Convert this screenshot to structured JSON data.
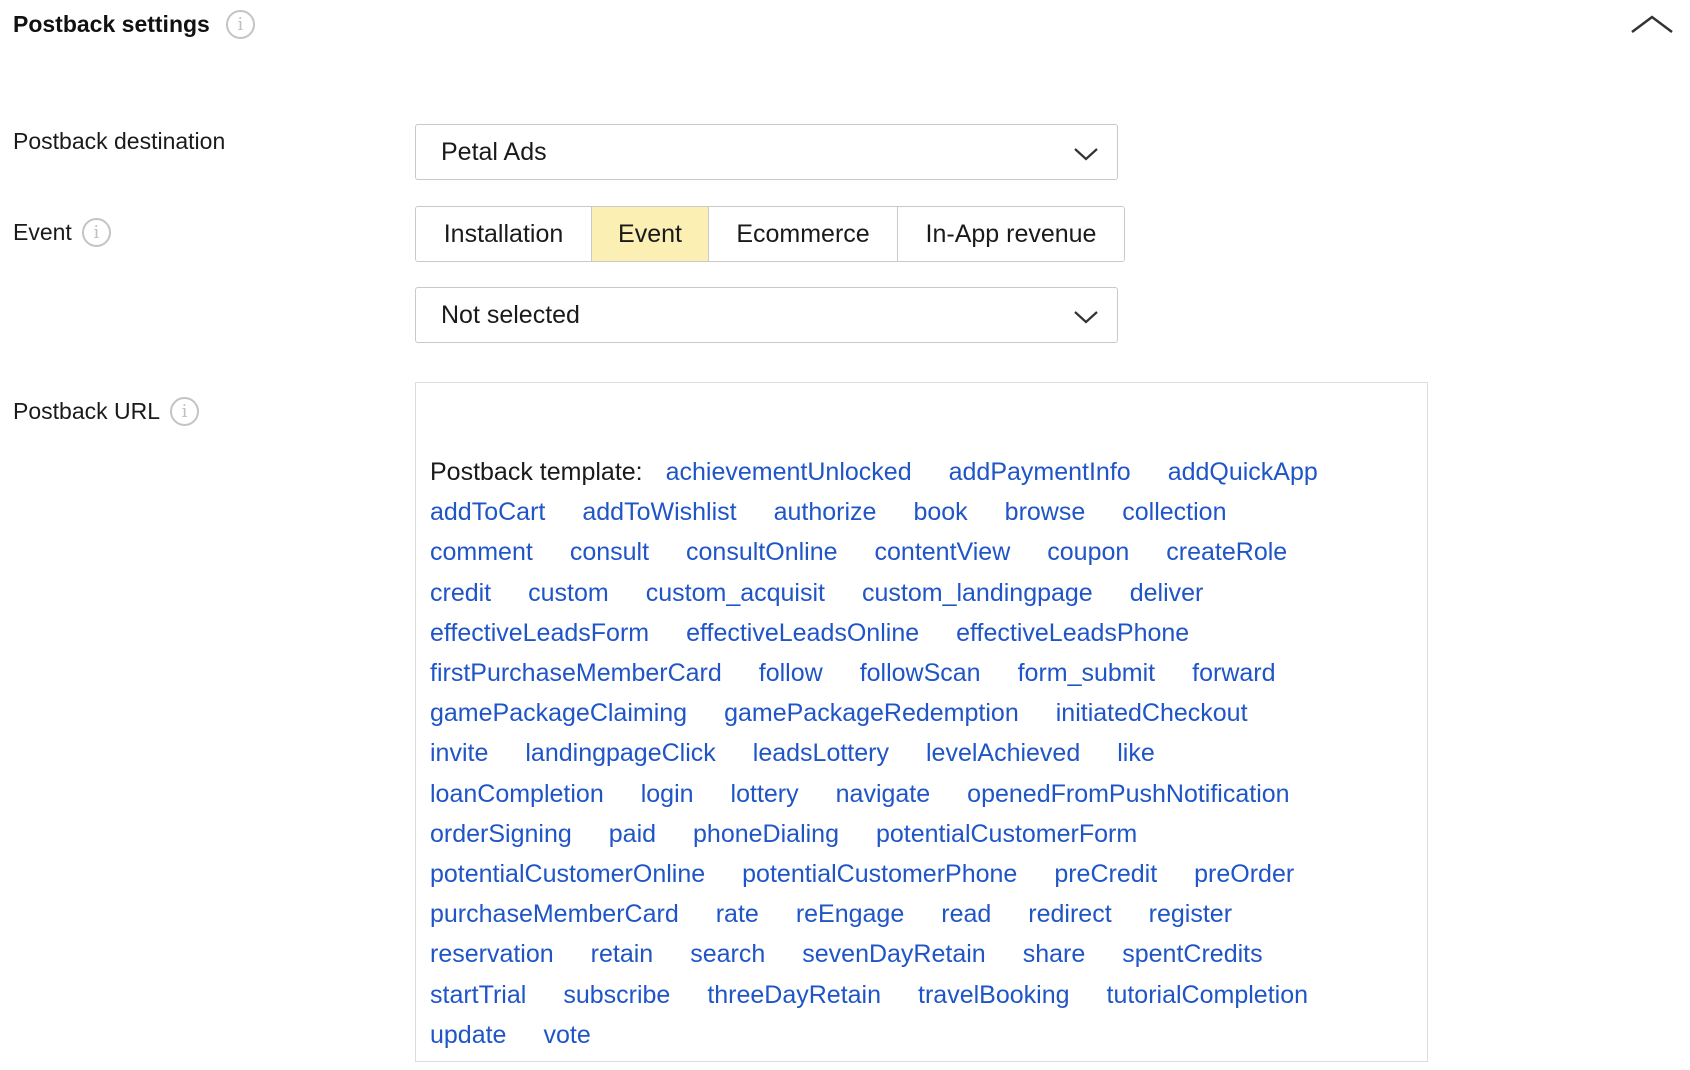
{
  "section": {
    "title": "Postback settings"
  },
  "destination": {
    "label": "Postback destination",
    "value": "Petal Ads"
  },
  "event": {
    "label": "Event",
    "tabs": [
      {
        "label": "Installation",
        "active": false
      },
      {
        "label": "Event",
        "active": true
      },
      {
        "label": "Ecommerce",
        "active": false
      },
      {
        "label": "In-App revenue",
        "active": false
      }
    ],
    "select_value": "Not selected"
  },
  "postback_url": {
    "label": "Postback URL",
    "template_label": "Postback template:",
    "template_lines": [
      [
        "achievementUnlocked",
        "addPaymentInfo",
        "addQuickApp"
      ],
      [
        "addToCart",
        "addToWishlist",
        "authorize",
        "book",
        "browse",
        "collection"
      ],
      [
        "comment",
        "consult",
        "consultOnline",
        "contentView",
        "coupon",
        "createRole"
      ],
      [
        "credit",
        "custom",
        "custom_acquisit",
        "custom_landingpage",
        "deliver"
      ],
      [
        "effectiveLeadsForm",
        "effectiveLeadsOnline",
        "effectiveLeadsPhone"
      ],
      [
        "firstPurchaseMemberCard",
        "follow",
        "followScan",
        "form_submit",
        "forward"
      ],
      [
        "gamePackageClaiming",
        "gamePackageRedemption",
        "initiatedCheckout"
      ],
      [
        "invite",
        "landingpageClick",
        "leadsLottery",
        "levelAchieved",
        "like"
      ],
      [
        "loanCompletion",
        "login",
        "lottery",
        "navigate",
        "openedFromPushNotification"
      ],
      [
        "orderSigning",
        "paid",
        "phoneDialing",
        "potentialCustomerForm"
      ],
      [
        "potentialCustomerOnline",
        "potentialCustomerPhone",
        "preCredit",
        "preOrder"
      ],
      [
        "purchaseMemberCard",
        "rate",
        "reEngage",
        "read",
        "redirect",
        "register"
      ],
      [
        "reservation",
        "retain",
        "search",
        "sevenDayRetain",
        "share",
        "spentCredits"
      ],
      [
        "startTrial",
        "subscribe",
        "threeDayRetain",
        "travelBooking",
        "tutorialCompletion"
      ],
      [
        "update",
        "vote"
      ]
    ]
  },
  "icons": {
    "info": "info-icon",
    "collapse": "chevron-up-icon",
    "dropdown": "chevron-down-icon"
  },
  "colors": {
    "link": "#1f55c6",
    "active_tab": "#fcefb4",
    "border": "#c9c9c9"
  }
}
